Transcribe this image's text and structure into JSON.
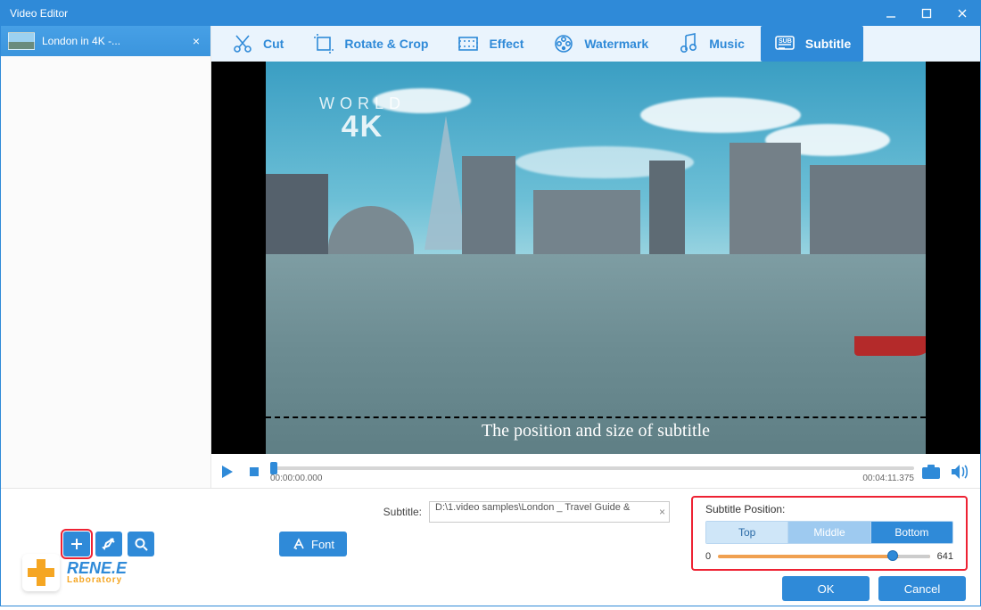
{
  "window": {
    "title": "Video Editor"
  },
  "sidebar": {
    "file_label": "London in 4K -..."
  },
  "tabs": {
    "cut": "Cut",
    "rotate": "Rotate & Crop",
    "effect": "Effect",
    "watermark": "Watermark",
    "music": "Music",
    "subtitle": "Subtitle"
  },
  "preview": {
    "watermark_line1": "WORLD",
    "watermark_line2": "4K",
    "subtitle_text": "The position and size of subtitle"
  },
  "playback": {
    "current_time": "00:00:00.000",
    "total_time": "00:04:11.375"
  },
  "subtitle_panel": {
    "label": "Subtitle:",
    "path": "D:\\1.video samples\\London _ Travel Guide &",
    "font_btn": "Font"
  },
  "position_panel": {
    "header": "Subtitle Position:",
    "top": "Top",
    "middle": "Middle",
    "bottom": "Bottom",
    "min": "0",
    "max": "641"
  },
  "logo": {
    "brand": "RENE.E",
    "sub": "Laboratory"
  },
  "actions": {
    "ok": "OK",
    "cancel": "Cancel"
  }
}
